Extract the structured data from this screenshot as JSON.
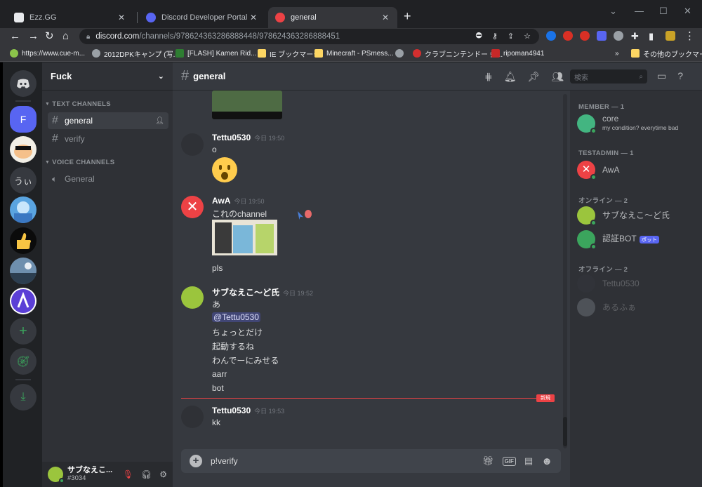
{
  "browser": {
    "tabs": [
      {
        "label": "Ezz.GG",
        "color": "#e8eaed"
      },
      {
        "label": "Discord Developer Portal — My A",
        "color": "#5865f2"
      },
      {
        "label": "general",
        "color": "#ed4245"
      }
    ],
    "new_tab": "+",
    "url_domain": "discord.com",
    "url_path": "/channels/978624363286888448/978624363286888451",
    "bookmarks": [
      {
        "label": "https://www.cue-m...",
        "color": "#8bc34a"
      },
      {
        "label": "2012DPKキャンプ (写...",
        "color": "#9aa0a6"
      },
      {
        "label": "[FLASH] Kamen Rid...",
        "color": "#2e7d32"
      },
      {
        "label": "IE ブックマーク",
        "color": "#fdd663"
      },
      {
        "label": "Minecraft - PSmess...",
        "color": "#fdd663"
      },
      {
        "label": "",
        "color": "#9aa0a6"
      },
      {
        "label": "クラブニンテンドー 会...",
        "color": "#d32f2f"
      },
      {
        "label": "ripoman4941",
        "color": "#c62828"
      }
    ],
    "more_bookmarks": "その他のブックマーク"
  },
  "server": {
    "name": "Fuck",
    "categories": {
      "text": "TEXT CHANNELS",
      "voice": "VOICE CHANNELS"
    },
    "text_channels": [
      "general",
      "verify"
    ],
    "voice_channels": [
      "General"
    ]
  },
  "guild_initials": {
    "f": "F",
    "ui": "うぃ"
  },
  "user": {
    "name": "サブなえこ...",
    "tag": "#3034"
  },
  "channel": {
    "title": "general",
    "search_placeholder": "検索"
  },
  "messages": [
    {
      "author": "Tettu0530",
      "time": "今日 19:50",
      "lines": [
        "o"
      ]
    },
    {
      "author": "AwA",
      "time": "今日 19:50",
      "lines": [
        "これのchannel"
      ],
      "after": "pls"
    },
    {
      "author": "サブなえこ～ど氏",
      "time": "今日 19:52",
      "lines": [
        "あ"
      ],
      "mention": "@Tettu0530",
      "more": [
        "ちょっとだけ",
        "起動するね",
        "わんでーにみせる",
        "aarr",
        "bot"
      ]
    },
    {
      "author": "Tettu0530",
      "time": "今日 19:53",
      "lines": [
        "kk"
      ]
    }
  ],
  "new_label": "新規",
  "composer": {
    "value": "p!verify"
  },
  "members": {
    "groups": {
      "member": "MEMBER — 1",
      "testadmin": "TESTADMIN — 1",
      "online": "オンライン — 2",
      "offline": "オフライン — 2"
    },
    "list": [
      {
        "name": "core",
        "status": "my condition? everytime bad",
        "color": "#43b581"
      },
      {
        "name": "AwA",
        "color": "#ed4245"
      },
      {
        "name": "サブなえこ～ど氏",
        "color": "#9bc53d"
      },
      {
        "name": "認証BOT",
        "badge": "ボット",
        "color": "#3ba55d"
      },
      {
        "name": "Tettu0530",
        "color": "#747f8d"
      },
      {
        "name": "あるふぁ",
        "color": "#747f8d"
      }
    ]
  },
  "colors": {
    "blurple": "#5865f2",
    "online": "#3ba55d",
    "red": "#ed4245"
  }
}
